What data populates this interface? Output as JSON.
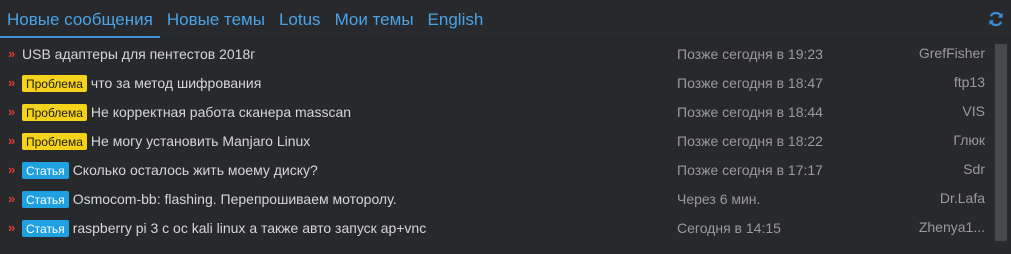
{
  "tabs": [
    {
      "label": "Новые сообщения",
      "active": true
    },
    {
      "label": "Новые темы",
      "active": false
    },
    {
      "label": "Lotus",
      "active": false
    },
    {
      "label": "Мои темы",
      "active": false
    },
    {
      "label": "English",
      "active": false
    }
  ],
  "refresh": {
    "icon": "refresh-icon"
  },
  "colors": {
    "accent": "#4aa3e6",
    "background": "#27292c",
    "problem_badge": "#f5d31a",
    "article_badge": "#1fa0e0",
    "arrow": "#e03b2f"
  },
  "rows": [
    {
      "badge": "",
      "badge_type": "",
      "title": "USB адаптеры для пентестов 2018г",
      "time": "Позже сегодня в 19:23",
      "author": "GrefFisher"
    },
    {
      "badge": "Проблема",
      "badge_type": "problem",
      "title": "что за метод шифрования",
      "time": "Позже сегодня в 18:47",
      "author": "ftp13"
    },
    {
      "badge": "Проблема",
      "badge_type": "problem",
      "title": "Не корректная работа сканера masscan",
      "time": "Позже сегодня в 18:44",
      "author": "VIS"
    },
    {
      "badge": "Проблема",
      "badge_type": "problem",
      "title": "Не могу установить Manjaro Linux",
      "time": "Позже сегодня в 18:22",
      "author": "Глюк"
    },
    {
      "badge": "Статья",
      "badge_type": "article",
      "title": "Сколько осталось жить моему диску?",
      "time": "Позже сегодня в 17:17",
      "author": "Sdr"
    },
    {
      "badge": "Статья",
      "badge_type": "article",
      "title": "Osmocom-bb: flashing. Перепрошиваем моторолу.",
      "time": "Через 6 мин.",
      "author": "Dr.Lafa"
    },
    {
      "badge": "Статья",
      "badge_type": "article",
      "title": "raspberry pi 3 с ос kali linux а также авто запуск ap+vnc",
      "time": "Сегодня в 14:15",
      "author": "Zhenya1..."
    }
  ]
}
